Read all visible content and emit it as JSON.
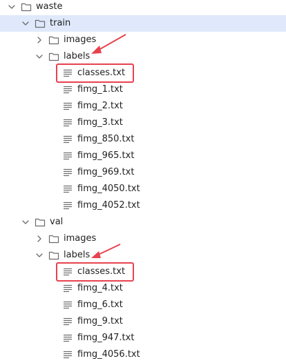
{
  "colors": {
    "selection_bg": "#dfe9fb",
    "highlight": "#e8414e",
    "icon": "#6a6a6a"
  },
  "tree": [
    {
      "label": "waste",
      "kind": "folder",
      "expanded": true,
      "depth": 0
    },
    {
      "label": "train",
      "kind": "folder",
      "expanded": true,
      "depth": 1,
      "selected": true
    },
    {
      "label": "images",
      "kind": "folder",
      "expanded": false,
      "depth": 2
    },
    {
      "label": "labels",
      "kind": "folder",
      "expanded": true,
      "depth": 2
    },
    {
      "label": "classes.txt",
      "kind": "file",
      "depth": 3,
      "highlighted": true
    },
    {
      "label": "fimg_1.txt",
      "kind": "file",
      "depth": 3
    },
    {
      "label": "fimg_2.txt",
      "kind": "file",
      "depth": 3
    },
    {
      "label": "fimg_3.txt",
      "kind": "file",
      "depth": 3
    },
    {
      "label": "fimg_850.txt",
      "kind": "file",
      "depth": 3
    },
    {
      "label": "fimg_965.txt",
      "kind": "file",
      "depth": 3
    },
    {
      "label": "fimg_969.txt",
      "kind": "file",
      "depth": 3
    },
    {
      "label": "fimg_4050.txt",
      "kind": "file",
      "depth": 3
    },
    {
      "label": "fimg_4052.txt",
      "kind": "file",
      "depth": 3
    },
    {
      "label": "val",
      "kind": "folder",
      "expanded": true,
      "depth": 1
    },
    {
      "label": "images",
      "kind": "folder",
      "expanded": false,
      "depth": 2
    },
    {
      "label": "labels",
      "kind": "folder",
      "expanded": true,
      "depth": 2
    },
    {
      "label": "classes.txt",
      "kind": "file",
      "depth": 3,
      "highlighted": true
    },
    {
      "label": "fimg_4.txt",
      "kind": "file",
      "depth": 3
    },
    {
      "label": "fimg_6.txt",
      "kind": "file",
      "depth": 3
    },
    {
      "label": "fimg_9.txt",
      "kind": "file",
      "depth": 3
    },
    {
      "label": "fimg_947.txt",
      "kind": "file",
      "depth": 3
    },
    {
      "label": "fimg_4056.txt",
      "kind": "file",
      "depth": 3
    }
  ]
}
